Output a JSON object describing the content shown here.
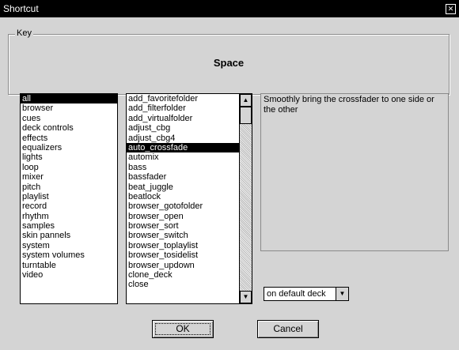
{
  "window": {
    "title": "Shortcut",
    "close_glyph": "✕"
  },
  "key": {
    "legend": "Key",
    "value": "Space"
  },
  "categories": {
    "items": [
      "all",
      "browser",
      "cues",
      "deck controls",
      "effects",
      "equalizers",
      "lights",
      "loop",
      "mixer",
      "pitch",
      "playlist",
      "record",
      "rhythm",
      "samples",
      "skin pannels",
      "system",
      "system volumes",
      "turntable",
      "video"
    ],
    "selected": "all"
  },
  "commands": {
    "items": [
      "add_favoritefolder",
      "add_filterfolder",
      "add_virtualfolder",
      "adjust_cbg",
      "adjust_cbg4",
      "auto_crossfade",
      "automix",
      "bass",
      "bassfader",
      "beat_juggle",
      "beatlock",
      "browser_gotofolder",
      "browser_open",
      "browser_sort",
      "browser_switch",
      "browser_toplaylist",
      "browser_tosidelist",
      "browser_updown",
      "clone_deck",
      "close"
    ],
    "selected": "auto_crossfade"
  },
  "description": "Smoothly bring the crossfader to one side or the other",
  "deck_select": {
    "value": "on default deck"
  },
  "buttons": {
    "ok": "OK",
    "cancel": "Cancel"
  },
  "icons": {
    "close": "close-icon",
    "scroll_up": "arrow-up-icon",
    "scroll_down": "arrow-down-icon",
    "dropdown": "chevron-down-icon"
  }
}
